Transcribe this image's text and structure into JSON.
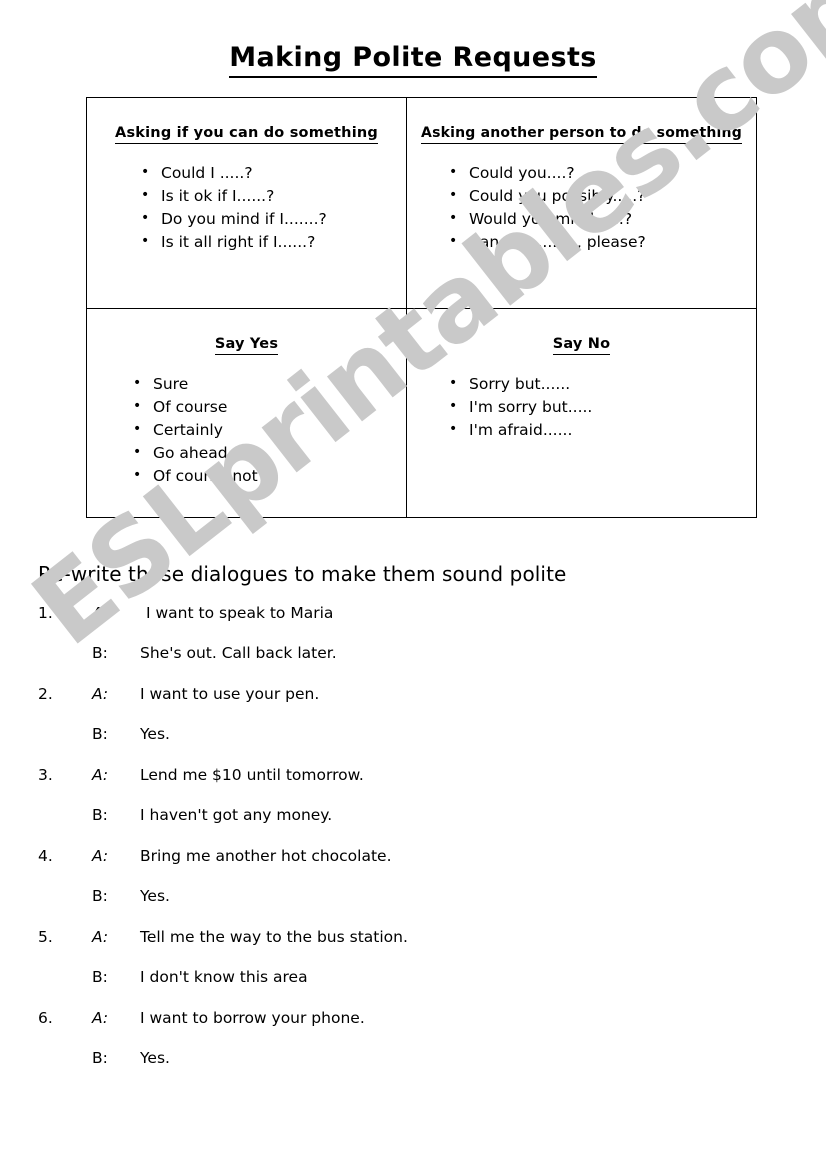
{
  "document": {
    "title": "Making Polite Requests",
    "watermark": "ESLprintables.com",
    "watermark_color": "#c9c9c9"
  },
  "table": {
    "cells": [
      {
        "heading": "Asking if you can do something",
        "items": [
          "Could I .....?",
          "Is it ok if I......?",
          "Do you mind if I.......?",
          "Is it all right if I......?"
        ]
      },
      {
        "heading": "Asking another person to do something",
        "items": [
          "Could you....?",
          "Could you possibly.....?",
          "Would you mind......?",
          "Can you........., please?"
        ]
      },
      {
        "heading": "Say Yes",
        "items": [
          "Sure",
          "Of course",
          "Certainly",
          "Go ahead",
          "Of course not"
        ]
      },
      {
        "heading": "Say No",
        "items": [
          "Sorry but......",
          "I'm sorry but.....",
          "I'm afraid......"
        ]
      }
    ]
  },
  "exercise": {
    "instruction": "Re-write these dialogues to make them sound polite",
    "speaker_a": "A:",
    "speaker_b": "B:",
    "dialogues": [
      {
        "number": "1.",
        "a": "I want to speak to Maria",
        "b": "She's out.   Call back later."
      },
      {
        "number": "2.",
        "a": "I want to use your pen.",
        "b": "Yes."
      },
      {
        "number": "3.",
        "a": "Lend me $10 until tomorrow.",
        "b": "I haven't got any money."
      },
      {
        "number": "4.",
        "a": "Bring me another hot chocolate.",
        "b": "Yes."
      },
      {
        "number": "5.",
        "a": "Tell me the way to the bus station.",
        "b": "I don't know this area"
      },
      {
        "number": "6.",
        "a": "I want to borrow your phone.",
        "b": "Yes."
      }
    ]
  }
}
